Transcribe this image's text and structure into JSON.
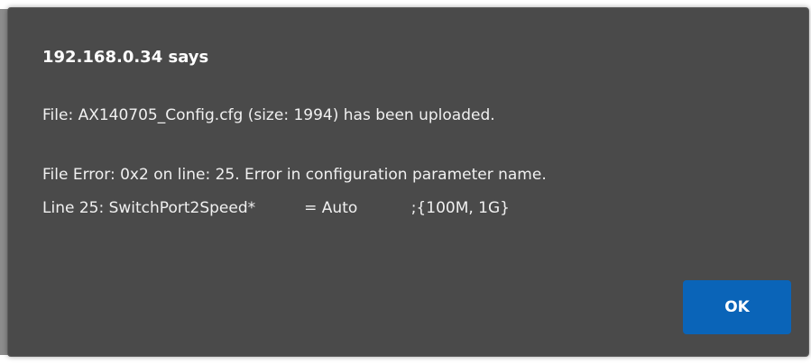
{
  "dialog": {
    "title": "192.168.0.34 says",
    "message_line_1": "File: AX140705_Config.cfg (size: 1994) has been uploaded.",
    "message_line_2": "File Error: 0x2 on line: 25. Error in configuration parameter name.",
    "message_line_3": "Line 25: SwitchPort2Speed*          = Auto           ;{100M, 1G}",
    "ok_label": "OK"
  },
  "colors": {
    "dialog_background": "#4a4a4a",
    "button_accent": "#0a64b8",
    "text": "#ffffff"
  }
}
